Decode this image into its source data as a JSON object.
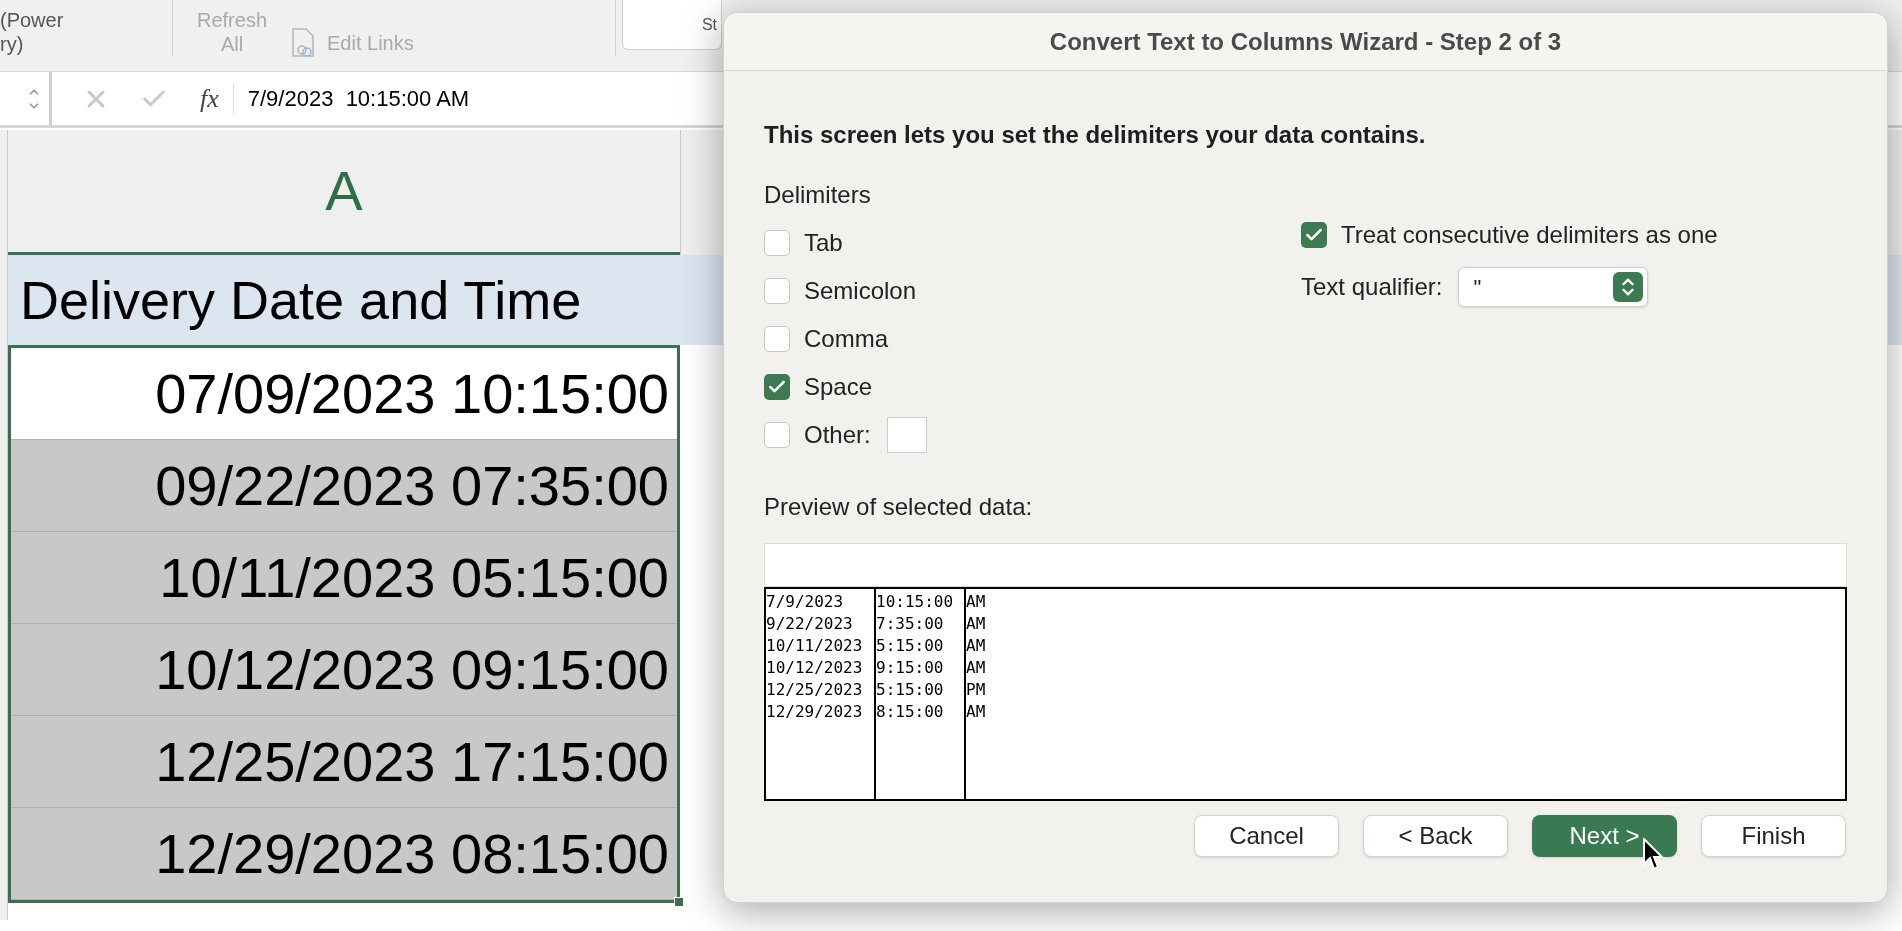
{
  "ribbon": {
    "group_label_lines": [
      "(Power",
      "ry)"
    ],
    "refresh_lines": [
      "Refresh",
      "All"
    ],
    "edit_links": "Edit Links",
    "style_fragment": "St"
  },
  "formula_bar": {
    "function_label": "fx",
    "value": "7/9/2023  10:15:00 AM"
  },
  "sheet": {
    "column_header": "A",
    "header_cell": "Delivery Date and Time",
    "rows": [
      {
        "value": "07/09/2023 10:15:00",
        "active": true
      },
      {
        "value": "09/22/2023 07:35:00",
        "active": false
      },
      {
        "value": "10/11/2023 05:15:00",
        "active": false
      },
      {
        "value": "10/12/2023 09:15:00",
        "active": false
      },
      {
        "value": "12/25/2023 17:15:00",
        "active": false
      },
      {
        "value": "12/29/2023 08:15:00",
        "active": false
      }
    ]
  },
  "dialog": {
    "title": "Convert Text to Columns Wizard - Step 2 of 3",
    "instruction": "This screen lets you set the delimiters your data contains.",
    "delimiters_label": "Delimiters",
    "delimiters": [
      {
        "label": "Tab",
        "checked": false,
        "kind": "plain"
      },
      {
        "label": "Semicolon",
        "checked": false,
        "kind": "plain"
      },
      {
        "label": "Comma",
        "checked": false,
        "kind": "plain"
      },
      {
        "label": "Space",
        "checked": true,
        "kind": "plain"
      },
      {
        "label": "Other:",
        "checked": false,
        "kind": "with_field"
      }
    ],
    "consecutive": {
      "label": "Treat consecutive delimiters as one",
      "checked": true
    },
    "text_qualifier": {
      "label": "Text qualifier:",
      "value": "\""
    },
    "preview_label": "Preview of selected data:",
    "preview_rows": [
      [
        "7/9/2023",
        "10:15:00",
        "AM"
      ],
      [
        "9/22/2023",
        "7:35:00",
        "AM"
      ],
      [
        "10/11/2023",
        "5:15:00",
        "AM"
      ],
      [
        "10/12/2023",
        "9:15:00",
        "AM"
      ],
      [
        "12/25/2023",
        "5:15:00",
        "PM"
      ],
      [
        "12/29/2023",
        "8:15:00",
        "AM"
      ]
    ],
    "buttons": [
      {
        "label": "Cancel",
        "primary": false
      },
      {
        "label": "< Back",
        "primary": false
      },
      {
        "label": "Next >",
        "primary": true
      },
      {
        "label": "Finish",
        "primary": false
      }
    ]
  }
}
